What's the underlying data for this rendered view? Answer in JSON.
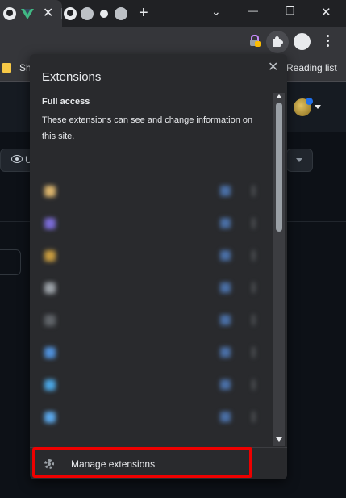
{
  "tabs": {
    "close_glyph": "✕",
    "new_tab_glyph": "+",
    "icons": [
      "github-icon",
      "vue-icon",
      "github-icon",
      "globe-icon",
      "swirl-icon",
      "globe-icon"
    ]
  },
  "window": {
    "minimize_glyph": "—",
    "restore_glyph": "❐",
    "close_glyph": "✕",
    "tab_search_glyph": "⌄"
  },
  "bookmarks": {
    "first_label": "Sh",
    "reading_list": "Reading list"
  },
  "page": {
    "watch_label": "U"
  },
  "extensions_popup": {
    "title": "Extensions",
    "close_glyph": "✕",
    "full_access_heading": "Full access",
    "full_access_desc": "These extensions can see and change information on this site.",
    "manage_label": "Manage extensions"
  },
  "colors": {
    "highlight": "#dd0000",
    "popup_bg": "#292a2d",
    "page_bg": "#0d1117"
  }
}
